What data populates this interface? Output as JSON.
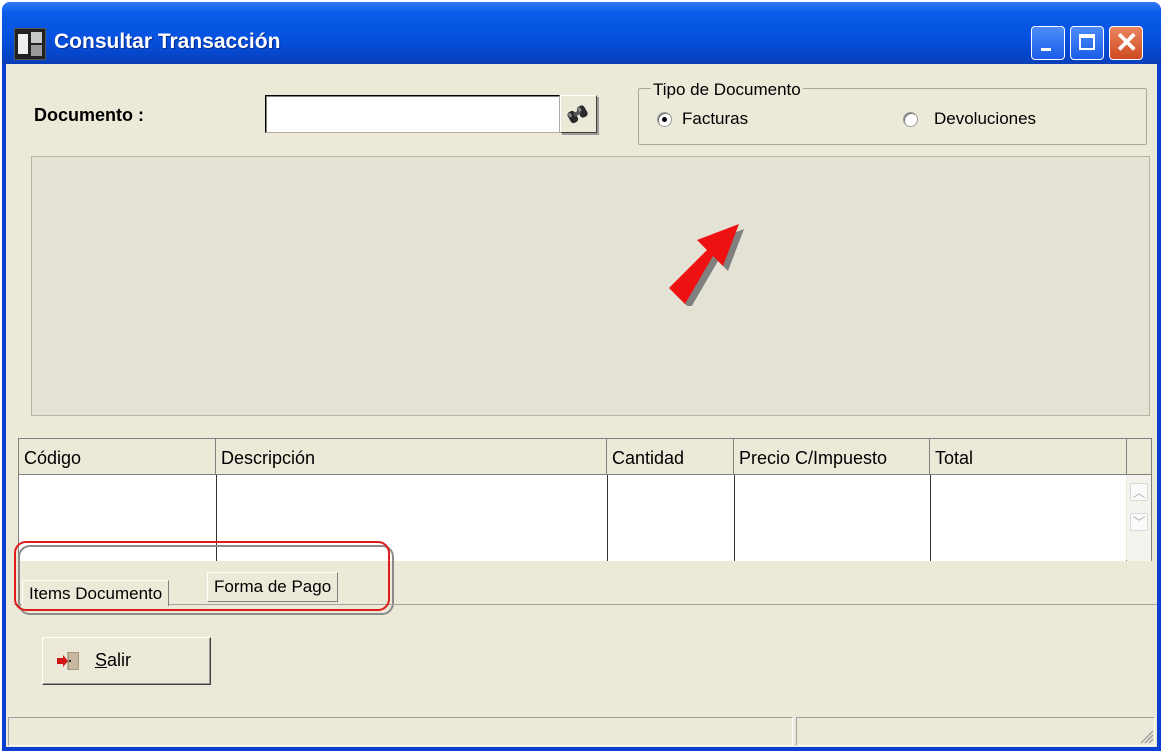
{
  "window": {
    "title": "Consultar Transacción"
  },
  "document": {
    "label": "Documento :",
    "value": ""
  },
  "document_type": {
    "legend": "Tipo de Documento",
    "options": [
      "Facturas",
      "Devoluciones"
    ],
    "selected": "Facturas"
  },
  "grid": {
    "columns": [
      "Código",
      "Descripción",
      "Cantidad",
      "Precio C/Impuesto",
      "Total"
    ],
    "rows": []
  },
  "tabs": [
    "Items Documento",
    "Forma de Pago"
  ],
  "buttons": {
    "exit_mnemonic": "S",
    "exit_rest": "alir"
  },
  "colors": {
    "annotation_red": "#dd1c1c",
    "titlebar_blue": "#0553e0"
  },
  "icons": {
    "app": "app-icon",
    "find": "binoculars-icon",
    "exit": "exit-door-icon"
  }
}
